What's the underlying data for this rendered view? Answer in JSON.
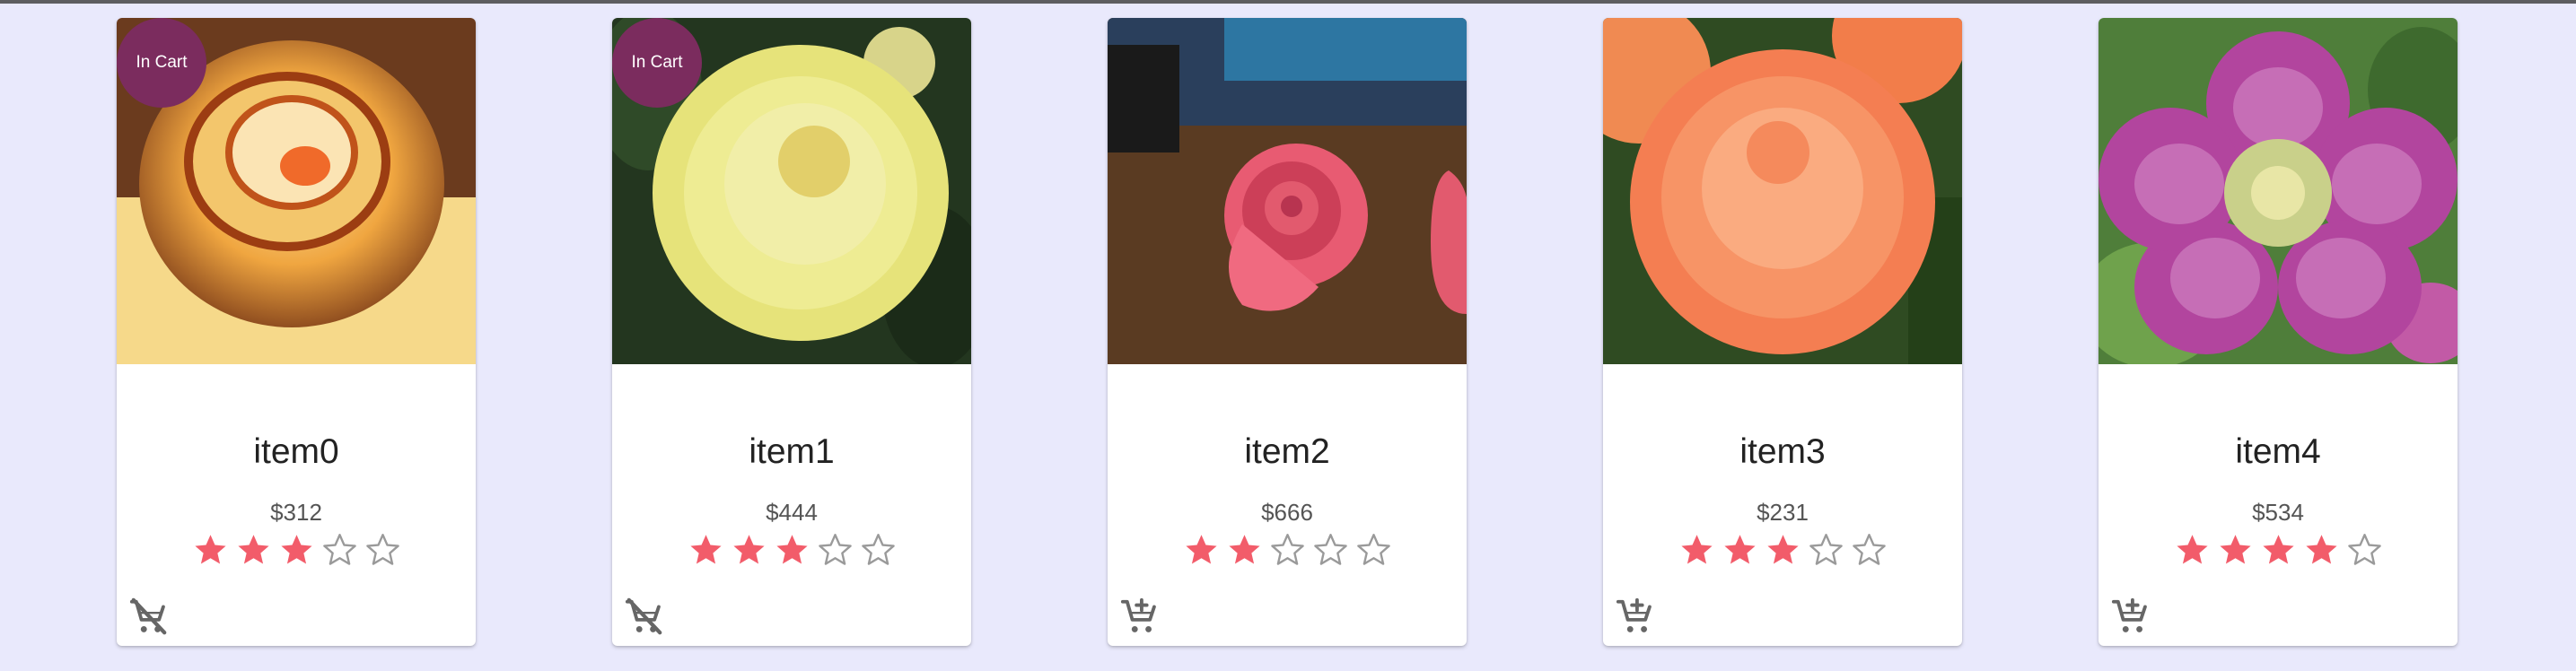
{
  "colors": {
    "background": "#e9e9fc",
    "badge": "#7b2c5e",
    "star_filled": "#f25c6a",
    "star_empty": "#9a9a9a",
    "icon": "#666666"
  },
  "products": [
    {
      "name": "item0",
      "price": "$312",
      "rating": 3,
      "max_rating": 5,
      "badge": "In Cart",
      "in_cart": true,
      "cart_icon": "remove-shopping-cart-icon",
      "image_icon": "rose-photo"
    },
    {
      "name": "item1",
      "price": "$444",
      "rating": 3,
      "max_rating": 5,
      "badge": "In Cart",
      "in_cart": true,
      "cart_icon": "remove-shopping-cart-icon",
      "image_icon": "yellow-dahlia-photo"
    },
    {
      "name": "item2",
      "price": "$666",
      "rating": 2,
      "max_rating": 5,
      "badge": "",
      "in_cart": false,
      "cart_icon": "add-shopping-cart-icon",
      "image_icon": "paper-rose-photo"
    },
    {
      "name": "item3",
      "price": "$231",
      "rating": 3,
      "max_rating": 5,
      "badge": "",
      "in_cart": false,
      "cart_icon": "add-shopping-cart-icon",
      "image_icon": "orange-dahlia-photo"
    },
    {
      "name": "item4",
      "price": "$534",
      "rating": 4,
      "max_rating": 5,
      "badge": "",
      "in_cart": false,
      "cart_icon": "add-shopping-cart-icon",
      "image_icon": "hellebore-photo"
    }
  ]
}
